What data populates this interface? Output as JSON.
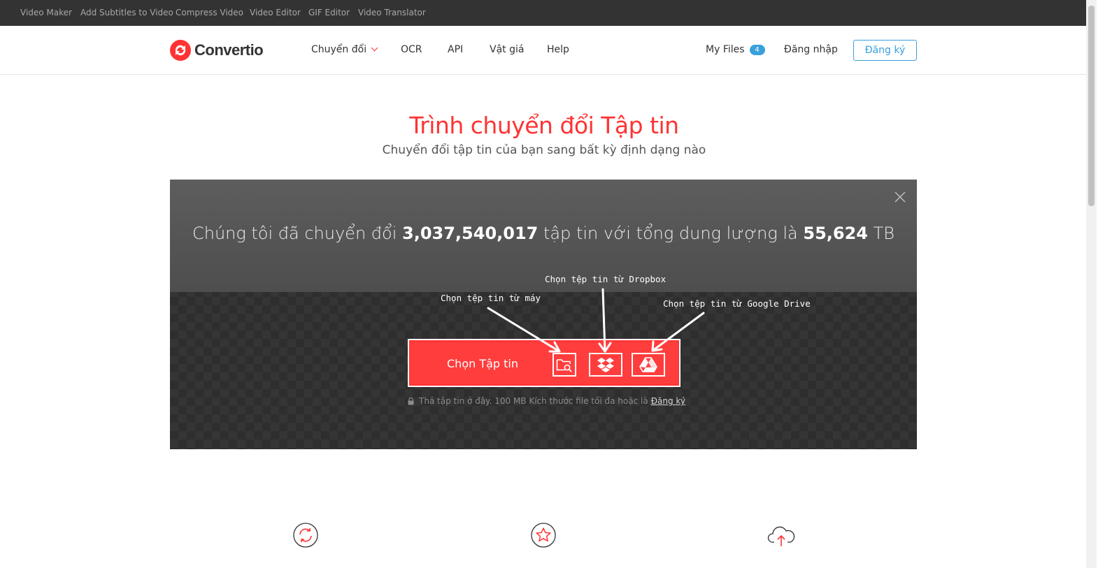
{
  "topbar": {
    "links": [
      "Video Maker",
      "Add Subtitles to Video",
      "Compress Video",
      "Video Editor",
      "GIF Editor",
      "Video Translator"
    ]
  },
  "header": {
    "brand": "Convertio",
    "nav": {
      "convert": "Chuyển đổi",
      "ocr": "OCR",
      "api": "API",
      "pricing": "Vật giá",
      "help": "Help"
    },
    "my_files": "My Files",
    "my_files_count": "4",
    "login": "Đăng nhập",
    "signup": "Đăng ký"
  },
  "hero": {
    "title": "Trình chuyển đổi Tập tin",
    "subtitle": "Chuyển đổi tập tin của bạn sang bất kỳ định dạng nào"
  },
  "stats": {
    "prefix": "Chúng tôi đã chuyển đổi",
    "files_count": "3,037,540,017",
    "middle": "tập tin với tổng dung lượng là",
    "total_size": "55,624",
    "unit": "TB"
  },
  "upload": {
    "choose_label": "Chọn Tập tin",
    "drop_note": "Thả tập tin ở đây. 100 MB Kích thước file tối đa hoặc là",
    "drop_note_link": "Đăng ký"
  },
  "annotations": {
    "from_computer": "Chọn tệp tin từ máy",
    "from_dropbox": "Chọn tệp tin từ Dropbox",
    "from_gdrive": "Chọn tệp tin từ Google Drive"
  },
  "icons": {
    "logo": "convertio-logo-icon",
    "close": "close-icon",
    "computer": "folder-search-icon",
    "dropbox": "dropbox-icon",
    "gdrive": "google-drive-icon",
    "lock": "lock-icon",
    "features": [
      "refresh-icon",
      "star-icon",
      "cloud-upload-icon"
    ]
  },
  "colors": {
    "brand_red": "#ff3333",
    "link_blue": "#3aa0dc",
    "topbar": "#333333"
  }
}
